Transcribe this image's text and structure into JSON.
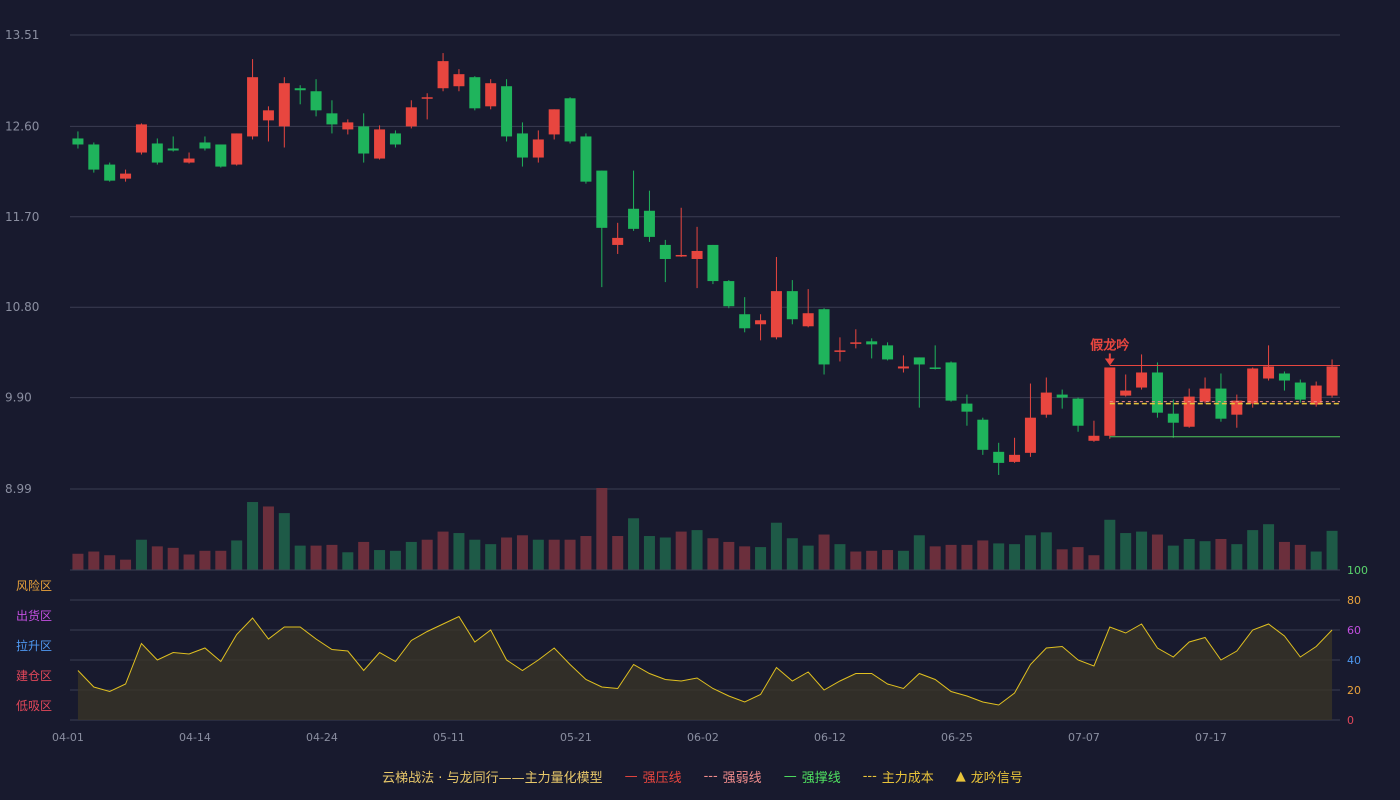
{
  "chart_data": {
    "type": "candlestick",
    "price_axis": {
      "ticks": [
        "13.51",
        "12.60",
        "11.70",
        "10.80",
        "9.90",
        "8.99"
      ],
      "values": [
        13.51,
        12.6,
        11.7,
        10.8,
        9.9,
        8.99
      ],
      "range": [
        8.99,
        13.51
      ]
    },
    "x_ticks": [
      {
        "index": 0,
        "label": "04-01"
      },
      {
        "index": 8,
        "label": "04-14"
      },
      {
        "index": 16,
        "label": "04-24"
      },
      {
        "index": 24,
        "label": "05-11"
      },
      {
        "index": 32,
        "label": "05-21"
      },
      {
        "index": 40,
        "label": "06-02"
      },
      {
        "index": 48,
        "label": "06-12"
      },
      {
        "index": 56,
        "label": "06-25"
      },
      {
        "index": 64,
        "label": "07-07"
      },
      {
        "index": 72,
        "label": "07-17"
      }
    ],
    "candles": [
      [
        12.48,
        12.42,
        12.55,
        12.38
      ],
      [
        12.42,
        12.17,
        12.44,
        12.14
      ],
      [
        12.22,
        12.06,
        12.24,
        12.05
      ],
      [
        12.08,
        12.13,
        12.17,
        12.05
      ],
      [
        12.34,
        12.62,
        12.63,
        12.32
      ],
      [
        12.43,
        12.24,
        12.48,
        12.22
      ],
      [
        12.38,
        12.36,
        12.5,
        12.35
      ],
      [
        12.24,
        12.28,
        12.34,
        12.23
      ],
      [
        12.44,
        12.38,
        12.5,
        12.36
      ],
      [
        12.42,
        12.2,
        12.42,
        12.19
      ],
      [
        12.22,
        12.53,
        12.53,
        12.21
      ],
      [
        12.5,
        13.09,
        13.27,
        12.47
      ],
      [
        12.66,
        12.76,
        12.8,
        12.45
      ],
      [
        12.6,
        13.03,
        13.09,
        12.39
      ],
      [
        12.98,
        12.96,
        13.01,
        12.82
      ],
      [
        12.95,
        12.76,
        13.07,
        12.7
      ],
      [
        12.73,
        12.62,
        12.86,
        12.53
      ],
      [
        12.57,
        12.64,
        12.67,
        12.52
      ],
      [
        12.6,
        12.33,
        12.73,
        12.24
      ],
      [
        12.28,
        12.57,
        12.61,
        12.27
      ],
      [
        12.53,
        12.42,
        12.56,
        12.39
      ],
      [
        12.6,
        12.79,
        12.86,
        12.58
      ],
      [
        12.89,
        12.89,
        12.93,
        12.67
      ],
      [
        12.98,
        13.25,
        13.33,
        12.95
      ],
      [
        13.0,
        13.12,
        13.17,
        12.95
      ],
      [
        13.09,
        12.78,
        13.1,
        12.76
      ],
      [
        12.8,
        13.03,
        13.07,
        12.77
      ],
      [
        13.0,
        12.5,
        13.07,
        12.45
      ],
      [
        12.53,
        12.29,
        12.64,
        12.2
      ],
      [
        12.29,
        12.47,
        12.56,
        12.24
      ],
      [
        12.52,
        12.77,
        12.77,
        12.47
      ],
      [
        12.88,
        12.45,
        12.89,
        12.43
      ],
      [
        12.5,
        12.05,
        12.53,
        12.03
      ],
      [
        12.16,
        11.59,
        12.16,
        11.0
      ],
      [
        11.42,
        11.49,
        11.64,
        11.33
      ],
      [
        11.78,
        11.58,
        12.16,
        11.56
      ],
      [
        11.76,
        11.5,
        11.96,
        11.45
      ],
      [
        11.42,
        11.28,
        11.47,
        11.05
      ],
      [
        11.31,
        11.32,
        11.79,
        11.3
      ],
      [
        11.28,
        11.36,
        11.6,
        10.99
      ],
      [
        11.42,
        11.06,
        11.42,
        11.03
      ],
      [
        11.06,
        10.81,
        11.07,
        10.79
      ],
      [
        10.73,
        10.59,
        10.9,
        10.55
      ],
      [
        10.63,
        10.67,
        10.73,
        10.47
      ],
      [
        10.5,
        10.96,
        11.3,
        10.48
      ],
      [
        10.96,
        10.68,
        11.07,
        10.63
      ],
      [
        10.61,
        10.74,
        10.98,
        10.6
      ],
      [
        10.78,
        10.23,
        10.79,
        10.13
      ],
      [
        10.36,
        10.37,
        10.5,
        10.26
      ],
      [
        10.44,
        10.45,
        10.58,
        10.39
      ],
      [
        10.46,
        10.43,
        10.49,
        10.29
      ],
      [
        10.42,
        10.28,
        10.45,
        10.27
      ],
      [
        10.19,
        10.21,
        10.32,
        10.15
      ],
      [
        10.3,
        10.23,
        10.3,
        9.8
      ],
      [
        10.2,
        10.19,
        10.42,
        10.18
      ],
      [
        10.25,
        9.87,
        10.26,
        9.86
      ],
      [
        9.84,
        9.76,
        9.93,
        9.62
      ],
      [
        9.68,
        9.38,
        9.7,
        9.33
      ],
      [
        9.36,
        9.25,
        9.45,
        9.13
      ],
      [
        9.26,
        9.33,
        9.5,
        9.25
      ],
      [
        9.35,
        9.7,
        10.04,
        9.31
      ],
      [
        9.73,
        9.95,
        10.1,
        9.7
      ],
      [
        9.93,
        9.9,
        9.98,
        9.79
      ],
      [
        9.89,
        9.62,
        9.9,
        9.56
      ],
      [
        9.47,
        9.52,
        9.67,
        9.46
      ],
      [
        9.52,
        10.2,
        10.2,
        9.49
      ],
      [
        9.92,
        9.97,
        10.13,
        9.91
      ],
      [
        10.0,
        10.15,
        10.33,
        9.98
      ],
      [
        10.15,
        9.75,
        10.25,
        9.7
      ],
      [
        9.74,
        9.65,
        9.88,
        9.5
      ],
      [
        9.61,
        9.91,
        9.99,
        9.6
      ],
      [
        9.86,
        9.99,
        10.1,
        9.84
      ],
      [
        9.99,
        9.69,
        10.14,
        9.66
      ],
      [
        9.73,
        9.87,
        9.93,
        9.6
      ],
      [
        9.84,
        10.19,
        10.2,
        9.8
      ],
      [
        10.09,
        10.21,
        10.42,
        10.07
      ],
      [
        10.14,
        10.07,
        10.16,
        9.97
      ],
      [
        10.05,
        9.88,
        10.08,
        9.85
      ],
      [
        9.83,
        10.02,
        10.06,
        9.81
      ],
      [
        9.92,
        10.21,
        10.28,
        9.9
      ]
    ],
    "volume": [
      22,
      25,
      20,
      14,
      41,
      32,
      30,
      21,
      26,
      26,
      40,
      92,
      86,
      77,
      33,
      33,
      34,
      24,
      38,
      27,
      26,
      38,
      41,
      52,
      50,
      41,
      35,
      44,
      47,
      41,
      41,
      41,
      46,
      111,
      46,
      70,
      46,
      44,
      52,
      54,
      43,
      38,
      32,
      31,
      64,
      43,
      33,
      48,
      35,
      25,
      26,
      27,
      26,
      47,
      32,
      34,
      34,
      40,
      36,
      35,
      47,
      51,
      28,
      31,
      20,
      68,
      50,
      52,
      48,
      33,
      42,
      39,
      42,
      35,
      54,
      62,
      38,
      34,
      25,
      53
    ],
    "volume_up": [
      true,
      true,
      true,
      true,
      false,
      true,
      true,
      true,
      true,
      true,
      false,
      false,
      true,
      false,
      false,
      true,
      true,
      false,
      true,
      false,
      false,
      false,
      true,
      true,
      false,
      false,
      false,
      true,
      true,
      false,
      true,
      true,
      true,
      true,
      true,
      false,
      false,
      false,
      true,
      false,
      true,
      true,
      true,
      false,
      false,
      false,
      false,
      true,
      false,
      true,
      true,
      true,
      false,
      false,
      true,
      true,
      true,
      true,
      false,
      false,
      false,
      false,
      true,
      true,
      true,
      false,
      false,
      false,
      true,
      false,
      false,
      false,
      true,
      false,
      false,
      false,
      true,
      true,
      false,
      false
    ],
    "indicator": {
      "ticks": [
        "0",
        "20",
        "40",
        "60",
        "80",
        "100"
      ],
      "tick_values": [
        0,
        20,
        40,
        60,
        80,
        100
      ],
      "tick_colors": [
        "#e2475a",
        "#e9a23b",
        "#4e98f0",
        "#c24fe0",
        "#e9a23b",
        "#59d46c"
      ],
      "zones": [
        "低吸区",
        "建仓区",
        "拉升区",
        "出货区",
        "风险区"
      ],
      "zone_colors": [
        "#e2475a",
        "#e2475a",
        "#4e98f0",
        "#c24fe0",
        "#e9a23b"
      ],
      "values": [
        33,
        22,
        19,
        24,
        51,
        40,
        45,
        44,
        48,
        39,
        57,
        68,
        54,
        62,
        62,
        54,
        47,
        46,
        33,
        45,
        39,
        53,
        59,
        64,
        69,
        52,
        60,
        40,
        33,
        40,
        48,
        37,
        27,
        22,
        21,
        37,
        31,
        27,
        26,
        28,
        21,
        16,
        12,
        17,
        35,
        26,
        32,
        20,
        26,
        31,
        31,
        24,
        21,
        31,
        27,
        19,
        16,
        12,
        10,
        18,
        37,
        48,
        49,
        40,
        36,
        62,
        58,
        64,
        48,
        42,
        52,
        55,
        40,
        46,
        60,
        64,
        56,
        42,
        49,
        60
      ]
    },
    "lines": {
      "strong_pressure": {
        "value": 10.22,
        "start": 65,
        "color": "#e8463f"
      },
      "main_cost": {
        "value": 9.84,
        "start": 65,
        "color": "#e8c33a"
      },
      "strong_weak": {
        "value": 9.86,
        "start": 65,
        "color": "#f08c8c"
      },
      "strong_support": {
        "value": 9.51,
        "start": 65,
        "color": "#4fc85a"
      }
    },
    "signal": {
      "index": 65,
      "label": "假龙吟",
      "color": "#e8463f"
    },
    "colors": {
      "up": "#e8463f",
      "down": "#1fb45c",
      "vol_up": "#6b2f3c",
      "vol_down": "#1e5a47",
      "indicator_line": "#e0c020",
      "grid": "#3a3d52",
      "axis_text": "#8a8ea0",
      "background": "#181a2e"
    }
  },
  "legend": [
    {
      "symbol": "",
      "label": "云梯战法 · 与龙同行——主力量化模型",
      "color": "#e8c86a"
    },
    {
      "symbol": "—",
      "label": "强压线",
      "color": "#e8463f"
    },
    {
      "symbol": "---",
      "label": "强弱线",
      "color": "#f08c8c"
    },
    {
      "symbol": "—",
      "label": "强撑线",
      "color": "#4fe060"
    },
    {
      "symbol": "---",
      "label": "主力成本",
      "color": "#e8c33a"
    },
    {
      "symbol": "▲",
      "label": "龙吟信号",
      "color": "#e8c33a"
    }
  ]
}
